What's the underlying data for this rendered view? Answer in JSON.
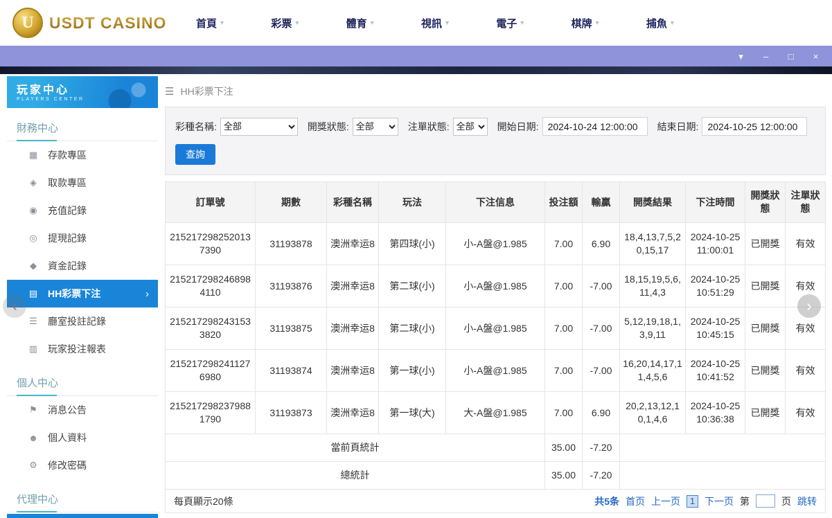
{
  "header": {
    "logo": {
      "text": "USDT CASINO",
      "monogram": "U"
    },
    "chevron_glyph": "▾",
    "nav_items": [
      {
        "id": "home",
        "label": "首頁"
      },
      {
        "id": "lottery",
        "label": "彩票"
      },
      {
        "id": "sports",
        "label": "體育"
      },
      {
        "id": "live",
        "label": "視訊"
      },
      {
        "id": "slots",
        "label": "電子"
      },
      {
        "id": "cards",
        "label": "棋牌"
      },
      {
        "id": "fishing",
        "label": "捕魚"
      }
    ]
  },
  "window_controls": {
    "collapse": "▾",
    "minimize": "–",
    "maximize": "□",
    "close": "×"
  },
  "sidebar": {
    "title": "玩家中心",
    "subtitle": "PLAYERS CENTER",
    "active_arrow": "›",
    "sections": [
      {
        "title": "財務中心",
        "items": [
          {
            "id": "deposit",
            "label": "存款專區",
            "icon": "deposit-icon",
            "glyph": "▦"
          },
          {
            "id": "withdraw",
            "label": "取款專區",
            "icon": "withdraw-icon",
            "glyph": "◈"
          },
          {
            "id": "recharge-record",
            "label": "充值記錄",
            "icon": "recharge-record-icon",
            "glyph": "◉"
          },
          {
            "id": "withdraw-record",
            "label": "提現記錄",
            "icon": "withdraw-record-icon",
            "glyph": "◎"
          },
          {
            "id": "funds-record",
            "label": "資金記錄",
            "icon": "funds-record-icon",
            "glyph": "◆"
          },
          {
            "id": "hh-lottery-bet",
            "label": "HH彩票下注",
            "icon": "lottery-bet-icon",
            "glyph": "▤",
            "active": true
          },
          {
            "id": "room-bet-record",
            "label": "廳室投註記錄",
            "icon": "room-record-icon",
            "glyph": "☰"
          },
          {
            "id": "player-bet-report",
            "label": "玩家投注報表",
            "icon": "report-icon",
            "glyph": "▥"
          }
        ]
      },
      {
        "title": "個人中心",
        "items": [
          {
            "id": "announcements",
            "label": "消息公告",
            "icon": "announcement-icon",
            "glyph": "⚑"
          },
          {
            "id": "profile",
            "label": "個人資料",
            "icon": "profile-icon",
            "glyph": "☻"
          },
          {
            "id": "change-password",
            "label": "修改密碼",
            "icon": "password-icon",
            "glyph": "⚙"
          }
        ]
      },
      {
        "title": "代理中心",
        "items": []
      }
    ]
  },
  "main": {
    "menu_icon": "☰",
    "breadcrumb": "HH彩票下注",
    "filters": {
      "lottery_label": "彩種名稱:",
      "lottery_value": "全部",
      "draw_status_label": "開獎狀態:",
      "draw_status_value": "全部",
      "order_status_label": "注單狀態:",
      "order_status_value": "全部",
      "start_label": "開始日期:",
      "start_value": "2024-10-24 12:00:00",
      "end_label": "結束日期:",
      "end_value": "2024-10-25 12:00:00",
      "query_button": "查詢"
    },
    "table": {
      "headers": [
        "訂單號",
        "期數",
        "彩種名稱",
        "玩法",
        "下注信息",
        "投注額",
        "輸贏",
        "開獎結果",
        "下注時間",
        "開獎狀態",
        "注單狀態"
      ],
      "rows": [
        {
          "order": "2152172982520137390",
          "period": "31193878",
          "lottery": "澳洲幸运8",
          "play": "第四球(小)",
          "info": "小-A盤@1.985",
          "bet": "7.00",
          "winloss": "6.90",
          "result": "18,4,13,7,5,20,15,17",
          "time": "2024-10-25 11:00:01",
          "draw_status": "已開獎",
          "order_status": "有效"
        },
        {
          "order": "2152172982468984110",
          "period": "31193876",
          "lottery": "澳洲幸运8",
          "play": "第二球(小)",
          "info": "小-A盤@1.985",
          "bet": "7.00",
          "winloss": "-7.00",
          "result": "18,15,19,5,6,11,4,3",
          "time": "2024-10-25 10:51:29",
          "draw_status": "已開獎",
          "order_status": "有效"
        },
        {
          "order": "2152172982431533820",
          "period": "31193875",
          "lottery": "澳洲幸运8",
          "play": "第二球(小)",
          "info": "小-A盤@1.985",
          "bet": "7.00",
          "winloss": "-7.00",
          "result": "5,12,19,18,1,3,9,11",
          "time": "2024-10-25 10:45:15",
          "draw_status": "已開獎",
          "order_status": "有效"
        },
        {
          "order": "2152172982411276980",
          "period": "31193874",
          "lottery": "澳洲幸运8",
          "play": "第一球(小)",
          "info": "小-A盤@1.985",
          "bet": "7.00",
          "winloss": "-7.00",
          "result": "16,20,14,17,11,4,5,6",
          "time": "2024-10-25 10:41:52",
          "draw_status": "已開獎",
          "order_status": "有效"
        },
        {
          "order": "2152172982379881790",
          "period": "31193873",
          "lottery": "澳洲幸运8",
          "play": "第一球(大)",
          "info": "大-A盤@1.985",
          "bet": "7.00",
          "winloss": "6.90",
          "result": "20,2,13,12,10,1,4,6",
          "time": "2024-10-25 10:36:38",
          "draw_status": "已開獎",
          "order_status": "有效"
        }
      ],
      "page_summary": {
        "label": "當前頁統計",
        "bet": "35.00",
        "winloss": "-7.20"
      },
      "total_summary": {
        "label": "總統計",
        "bet": "35.00",
        "winloss": "-7.20"
      }
    },
    "pagination": {
      "per_page": "每頁顯示20條",
      "total": "共5条",
      "first": "首页",
      "prev": "上一页",
      "current": "1",
      "next": "下一页",
      "jump_prefix": "第",
      "jump_suffix": "页",
      "jump_action": "跳转",
      "jump_value": ""
    }
  },
  "overlay_arrows": {
    "left": "‹",
    "right": "›"
  }
}
